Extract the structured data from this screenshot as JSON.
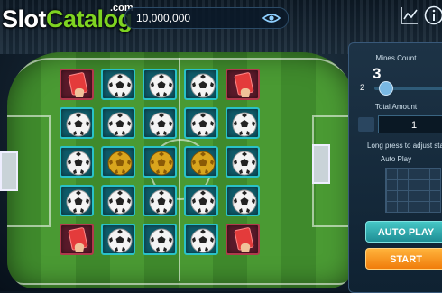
{
  "brand": {
    "word_left": "Slot",
    "word_right": "Catalog",
    "suffix": ".com"
  },
  "balance": {
    "value": "10,000,000"
  },
  "icons": {
    "eye": "eye-icon",
    "chart": "chart-icon",
    "info": "info-icon"
  },
  "panel": {
    "mines_label": "Mines Count",
    "mines_value": "3",
    "mines_min": "2",
    "mines_slider_level": 0.05,
    "total_amount_label": "Total Amount",
    "total_amount_value": "1",
    "hint": "Long press to adjust sta",
    "auto_play_label": "Auto Play",
    "auto_play_button": "AUTO PLAY",
    "start_button": "START"
  },
  "grid": {
    "rows": 5,
    "cols": 5,
    "cells": [
      "red-card",
      "ball",
      "ball",
      "ball",
      "red-card",
      "ball",
      "ball",
      "ball",
      "ball",
      "ball",
      "ball",
      "gold-ball",
      "gold-ball",
      "gold-ball",
      "ball",
      "ball",
      "ball",
      "ball",
      "ball",
      "ball",
      "red-card",
      "ball",
      "ball",
      "ball",
      "red-card"
    ]
  },
  "colors": {
    "tile_border": "#29c2c8",
    "card_border": "#b03a4c",
    "start": "#f59a1e",
    "auto": "#2fb0b3",
    "brand_green": "#7ed321"
  }
}
